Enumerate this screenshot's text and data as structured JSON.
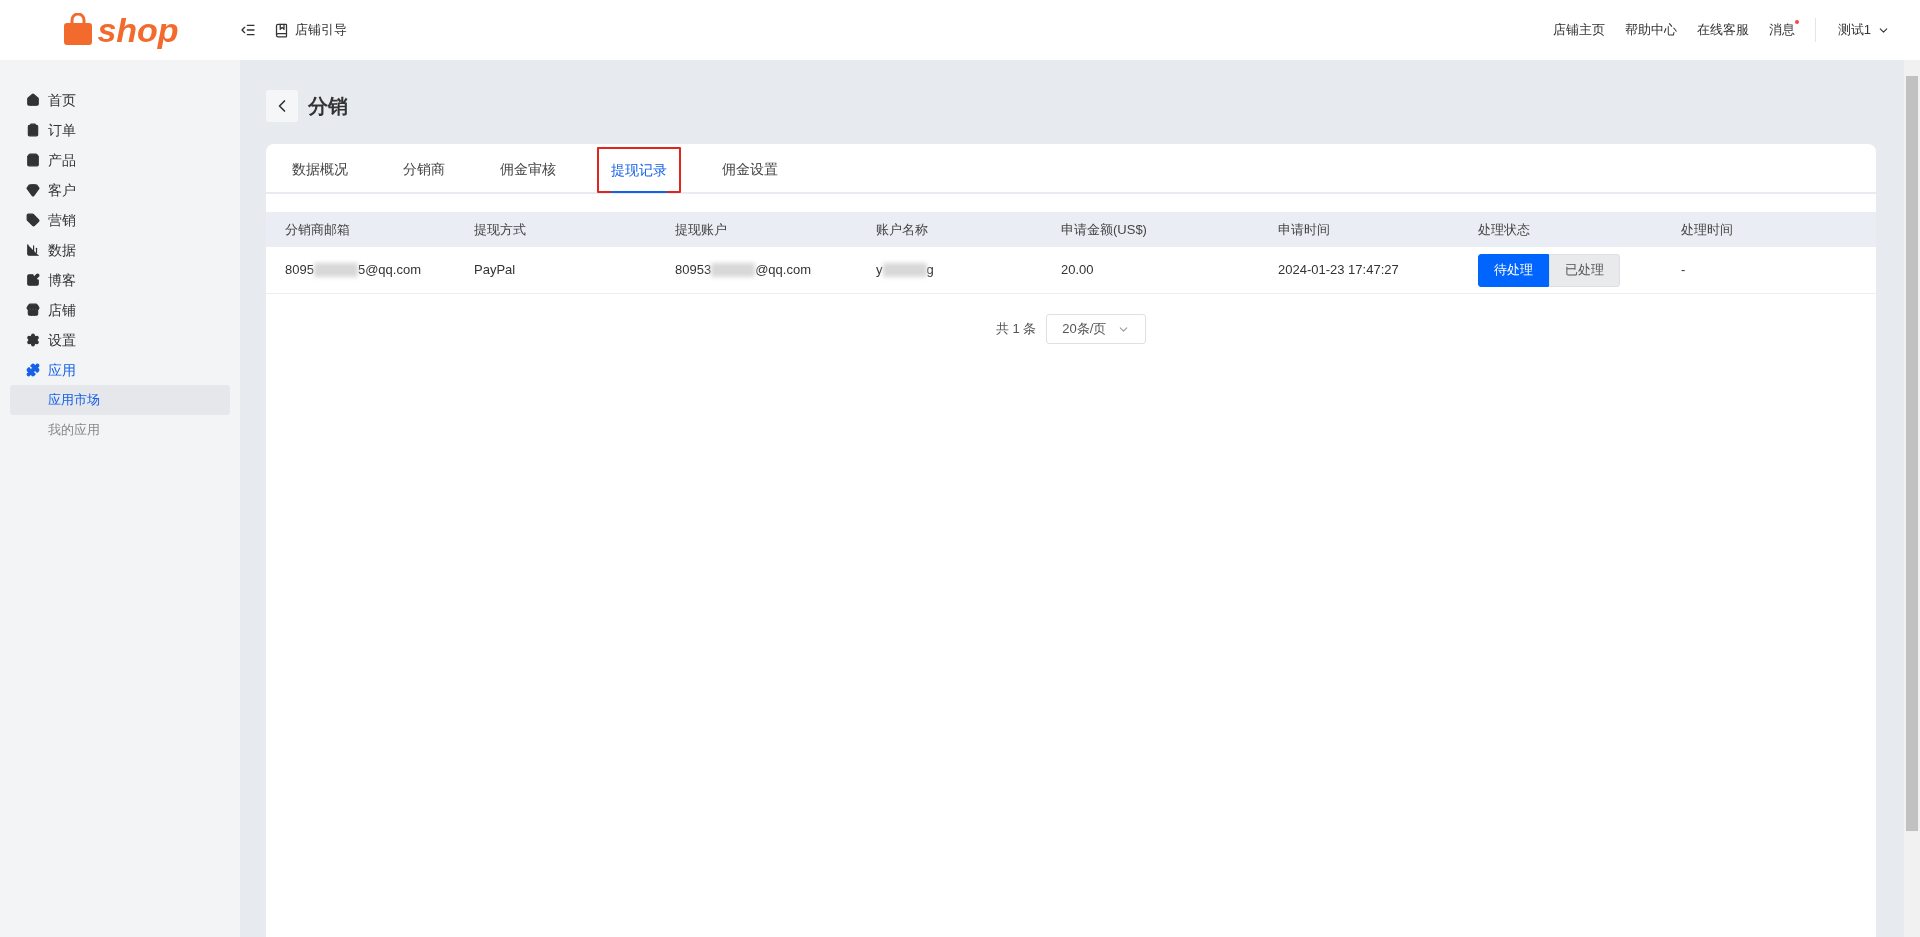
{
  "header": {
    "logo": "shop",
    "guide": "店铺引导",
    "links": [
      "店铺主页",
      "帮助中心",
      "在线客服"
    ],
    "messages": {
      "label": "消息",
      "unread": true
    },
    "user": "测试1"
  },
  "sidebar": {
    "items": [
      {
        "label": "首页",
        "selected": false
      },
      {
        "label": "订单",
        "selected": false
      },
      {
        "label": "产品",
        "selected": false
      },
      {
        "label": "客户",
        "selected": false
      },
      {
        "label": "营销",
        "selected": false
      },
      {
        "label": "数据",
        "selected": false
      },
      {
        "label": "博客",
        "selected": false
      },
      {
        "label": "店铺",
        "selected": false
      },
      {
        "label": "设置",
        "selected": false
      },
      {
        "label": "应用",
        "selected": true,
        "expanded": true,
        "children": [
          {
            "label": "应用市场",
            "selected": true
          },
          {
            "label": "我的应用",
            "selected": false
          }
        ]
      }
    ]
  },
  "page": {
    "title": "分销"
  },
  "tabs": [
    {
      "label": "数据概况",
      "selected": false,
      "highlighted": false
    },
    {
      "label": "分销商",
      "selected": false,
      "highlighted": false
    },
    {
      "label": "佣金审核",
      "selected": false,
      "highlighted": false
    },
    {
      "label": "提现记录",
      "selected": true,
      "highlighted": true
    },
    {
      "label": "佣金设置",
      "selected": false,
      "highlighted": false
    }
  ],
  "table": {
    "columns": [
      "分销商邮箱",
      "提现方式",
      "提现账户",
      "账户名称",
      "申请金额(US$)",
      "申请时间",
      "处理状态",
      "处理时间"
    ],
    "rows": [
      {
        "email": {
          "prefix": "8095",
          "suffix": "5@qq.com"
        },
        "method": "PayPal",
        "account": {
          "prefix": "80953",
          "suffix": "@qq.com"
        },
        "account_name": {
          "prefix": "y",
          "suffix": "g"
        },
        "amount": "20.00",
        "applied_at": "2024-01-23 17:47:27",
        "status": [
          {
            "label": "待处理",
            "selected": true
          },
          {
            "label": "已处理",
            "selected": false
          }
        ],
        "processed_at": "-"
      }
    ]
  },
  "pagination": {
    "total": "共 1 条",
    "page_size": "20条/页"
  }
}
